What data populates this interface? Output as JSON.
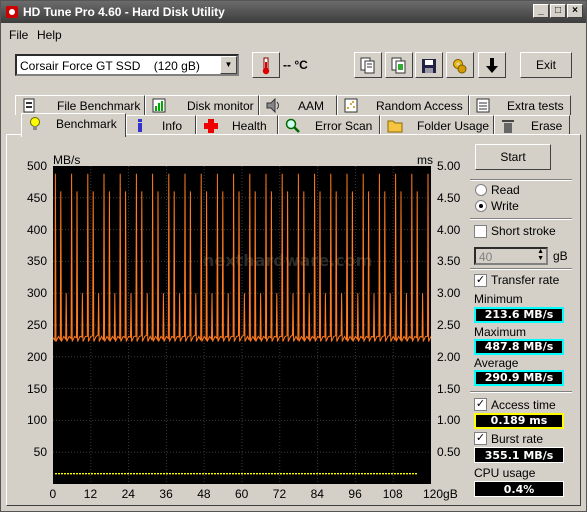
{
  "window": {
    "title": "HD Tune Pro 4.60 - Hard Disk Utility"
  },
  "menu": {
    "file": "File",
    "help": "Help"
  },
  "toolbar": {
    "drive": "Corsair Force GT SSD    (120 gB)",
    "temperature": "-- °C",
    "exit_label": "Exit"
  },
  "tabs_top": [
    {
      "label": "File Benchmark",
      "icon": "file-benchmark-icon"
    },
    {
      "label": "Disk monitor",
      "icon": "disk-monitor-icon"
    },
    {
      "label": "AAM",
      "icon": "speaker-icon"
    },
    {
      "label": "Random Access",
      "icon": "random-access-icon"
    },
    {
      "label": "Extra tests",
      "icon": "extra-tests-icon"
    }
  ],
  "tabs_bottom": [
    {
      "label": "Benchmark",
      "icon": "lightbulb-icon"
    },
    {
      "label": "Info",
      "icon": "info-icon"
    },
    {
      "label": "Health",
      "icon": "health-cross-icon"
    },
    {
      "label": "Error Scan",
      "icon": "magnifier-icon"
    },
    {
      "label": "Folder Usage",
      "icon": "folder-icon"
    },
    {
      "label": "Erase",
      "icon": "trash-icon"
    }
  ],
  "controls": {
    "start_label": "Start",
    "read_label": "Read",
    "write_label": "Write",
    "mode_selected": "Write",
    "short_stroke_label": "Short stroke",
    "short_stroke_checked": false,
    "short_stroke_value": "40",
    "short_stroke_unit": "gB",
    "transfer_rate_label": "Transfer rate",
    "transfer_rate_checked": true,
    "access_time_label": "Access time",
    "access_time_checked": true,
    "burst_rate_label": "Burst rate",
    "burst_rate_checked": true
  },
  "stats": {
    "minimum_label": "Minimum",
    "minimum": "213.6 MB/s",
    "maximum_label": "Maximum",
    "maximum": "487.8 MB/s",
    "average_label": "Average",
    "average": "290.9 MB/s",
    "access_time": "0.189 ms",
    "burst_rate": "355.1 MB/s",
    "cpu_label": "CPU usage",
    "cpu_usage": "0.4%"
  },
  "colors": {
    "transfer_line": "#ff7a20",
    "access_dots": "#ffff00",
    "cyan_box": "#00ffff",
    "yellow_box": "#ffff00"
  },
  "watermark": "nexthardware.com",
  "chart_data": {
    "type": "line",
    "ylabel_left": "MB/s",
    "ylabel_right": "ms",
    "y_left_ticks": [
      "500",
      "450",
      "400",
      "350",
      "300",
      "250",
      "200",
      "150",
      "100",
      "50"
    ],
    "y_right_ticks": [
      "5.00",
      "4.50",
      "4.00",
      "3.50",
      "3.00",
      "2.50",
      "2.00",
      "1.50",
      "1.00",
      "0.50"
    ],
    "x_ticks": [
      "0",
      "12",
      "24",
      "36",
      "48",
      "60",
      "72",
      "84",
      "96",
      "108",
      "120gB"
    ],
    "xlim": [
      0,
      120
    ],
    "ylim_left": [
      0,
      500
    ],
    "ylim_right": [
      0,
      5
    ],
    "grid": true,
    "series": [
      {
        "name": "Transfer rate",
        "baseline": 230,
        "minimum": 213.6,
        "maximum": 487.8,
        "average": 290.9
      },
      {
        "name": "Access time",
        "value_ms": 0.189
      }
    ]
  }
}
